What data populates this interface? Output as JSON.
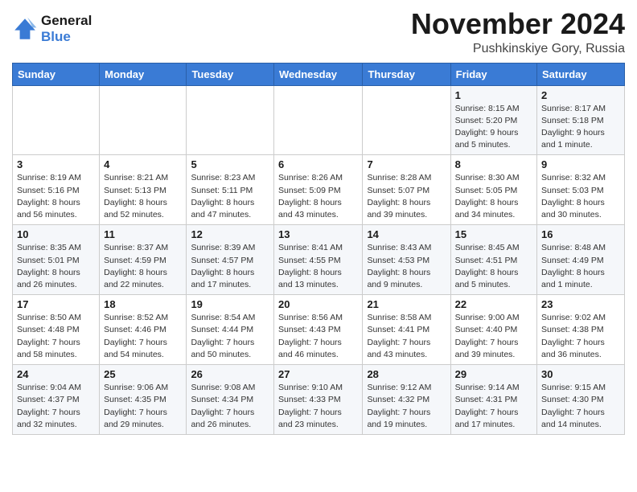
{
  "header": {
    "logo_line1": "General",
    "logo_line2": "Blue",
    "month": "November 2024",
    "location": "Pushkinskiye Gory, Russia"
  },
  "days_of_week": [
    "Sunday",
    "Monday",
    "Tuesday",
    "Wednesday",
    "Thursday",
    "Friday",
    "Saturday"
  ],
  "weeks": [
    [
      {
        "day": "",
        "info": ""
      },
      {
        "day": "",
        "info": ""
      },
      {
        "day": "",
        "info": ""
      },
      {
        "day": "",
        "info": ""
      },
      {
        "day": "",
        "info": ""
      },
      {
        "day": "1",
        "info": "Sunrise: 8:15 AM\nSunset: 5:20 PM\nDaylight: 9 hours\nand 5 minutes."
      },
      {
        "day": "2",
        "info": "Sunrise: 8:17 AM\nSunset: 5:18 PM\nDaylight: 9 hours\nand 1 minute."
      }
    ],
    [
      {
        "day": "3",
        "info": "Sunrise: 8:19 AM\nSunset: 5:16 PM\nDaylight: 8 hours\nand 56 minutes."
      },
      {
        "day": "4",
        "info": "Sunrise: 8:21 AM\nSunset: 5:13 PM\nDaylight: 8 hours\nand 52 minutes."
      },
      {
        "day": "5",
        "info": "Sunrise: 8:23 AM\nSunset: 5:11 PM\nDaylight: 8 hours\nand 47 minutes."
      },
      {
        "day": "6",
        "info": "Sunrise: 8:26 AM\nSunset: 5:09 PM\nDaylight: 8 hours\nand 43 minutes."
      },
      {
        "day": "7",
        "info": "Sunrise: 8:28 AM\nSunset: 5:07 PM\nDaylight: 8 hours\nand 39 minutes."
      },
      {
        "day": "8",
        "info": "Sunrise: 8:30 AM\nSunset: 5:05 PM\nDaylight: 8 hours\nand 34 minutes."
      },
      {
        "day": "9",
        "info": "Sunrise: 8:32 AM\nSunset: 5:03 PM\nDaylight: 8 hours\nand 30 minutes."
      }
    ],
    [
      {
        "day": "10",
        "info": "Sunrise: 8:35 AM\nSunset: 5:01 PM\nDaylight: 8 hours\nand 26 minutes."
      },
      {
        "day": "11",
        "info": "Sunrise: 8:37 AM\nSunset: 4:59 PM\nDaylight: 8 hours\nand 22 minutes."
      },
      {
        "day": "12",
        "info": "Sunrise: 8:39 AM\nSunset: 4:57 PM\nDaylight: 8 hours\nand 17 minutes."
      },
      {
        "day": "13",
        "info": "Sunrise: 8:41 AM\nSunset: 4:55 PM\nDaylight: 8 hours\nand 13 minutes."
      },
      {
        "day": "14",
        "info": "Sunrise: 8:43 AM\nSunset: 4:53 PM\nDaylight: 8 hours\nand 9 minutes."
      },
      {
        "day": "15",
        "info": "Sunrise: 8:45 AM\nSunset: 4:51 PM\nDaylight: 8 hours\nand 5 minutes."
      },
      {
        "day": "16",
        "info": "Sunrise: 8:48 AM\nSunset: 4:49 PM\nDaylight: 8 hours\nand 1 minute."
      }
    ],
    [
      {
        "day": "17",
        "info": "Sunrise: 8:50 AM\nSunset: 4:48 PM\nDaylight: 7 hours\nand 58 minutes."
      },
      {
        "day": "18",
        "info": "Sunrise: 8:52 AM\nSunset: 4:46 PM\nDaylight: 7 hours\nand 54 minutes."
      },
      {
        "day": "19",
        "info": "Sunrise: 8:54 AM\nSunset: 4:44 PM\nDaylight: 7 hours\nand 50 minutes."
      },
      {
        "day": "20",
        "info": "Sunrise: 8:56 AM\nSunset: 4:43 PM\nDaylight: 7 hours\nand 46 minutes."
      },
      {
        "day": "21",
        "info": "Sunrise: 8:58 AM\nSunset: 4:41 PM\nDaylight: 7 hours\nand 43 minutes."
      },
      {
        "day": "22",
        "info": "Sunrise: 9:00 AM\nSunset: 4:40 PM\nDaylight: 7 hours\nand 39 minutes."
      },
      {
        "day": "23",
        "info": "Sunrise: 9:02 AM\nSunset: 4:38 PM\nDaylight: 7 hours\nand 36 minutes."
      }
    ],
    [
      {
        "day": "24",
        "info": "Sunrise: 9:04 AM\nSunset: 4:37 PM\nDaylight: 7 hours\nand 32 minutes."
      },
      {
        "day": "25",
        "info": "Sunrise: 9:06 AM\nSunset: 4:35 PM\nDaylight: 7 hours\nand 29 minutes."
      },
      {
        "day": "26",
        "info": "Sunrise: 9:08 AM\nSunset: 4:34 PM\nDaylight: 7 hours\nand 26 minutes."
      },
      {
        "day": "27",
        "info": "Sunrise: 9:10 AM\nSunset: 4:33 PM\nDaylight: 7 hours\nand 23 minutes."
      },
      {
        "day": "28",
        "info": "Sunrise: 9:12 AM\nSunset: 4:32 PM\nDaylight: 7 hours\nand 19 minutes."
      },
      {
        "day": "29",
        "info": "Sunrise: 9:14 AM\nSunset: 4:31 PM\nDaylight: 7 hours\nand 17 minutes."
      },
      {
        "day": "30",
        "info": "Sunrise: 9:15 AM\nSunset: 4:30 PM\nDaylight: 7 hours\nand 14 minutes."
      }
    ]
  ]
}
